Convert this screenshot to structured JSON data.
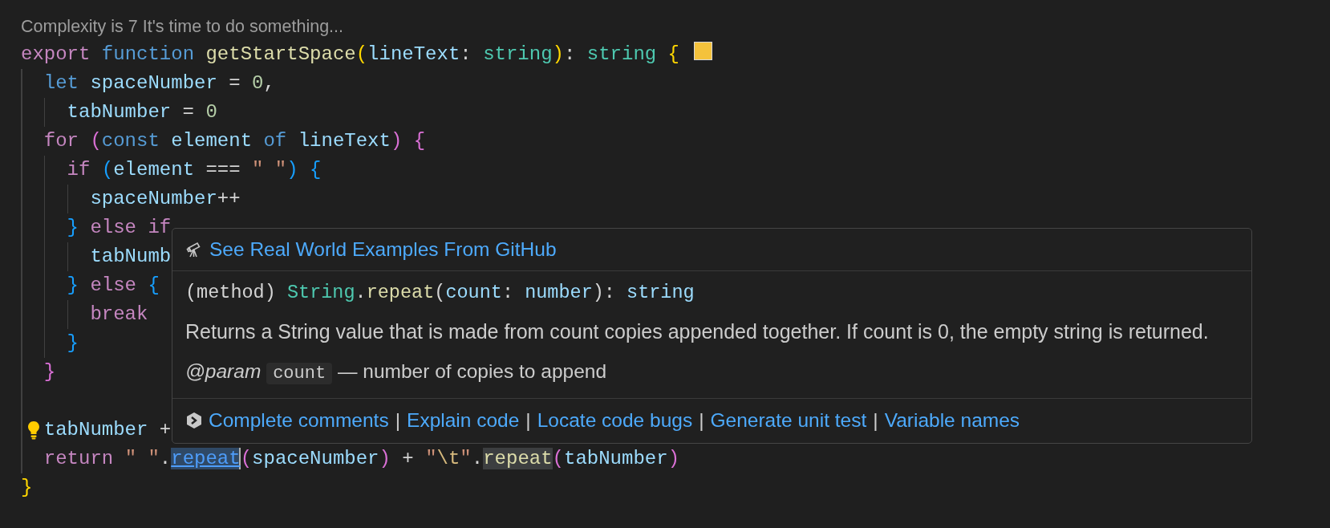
{
  "codelens": "Complexity is 7 It's time to do something...",
  "code": [
    {
      "swatch": true,
      "tokens": [
        {
          "kind": "kw",
          "text": "export "
        },
        {
          "kind": "st",
          "text": "function "
        },
        {
          "kind": "fn",
          "text": "getStartSpace"
        },
        {
          "kind": "b1",
          "text": "("
        },
        {
          "kind": "var",
          "text": "lineText"
        },
        {
          "kind": "op",
          "text": ": "
        },
        {
          "kind": "type",
          "text": "string"
        },
        {
          "kind": "b1",
          "text": ")"
        },
        {
          "kind": "op",
          "text": ": "
        },
        {
          "kind": "type",
          "text": "string "
        },
        {
          "kind": "b1",
          "text": "{"
        }
      ],
      "children": [
        {
          "tokens": [
            {
              "kind": "st",
              "text": "let "
            },
            {
              "kind": "var",
              "text": "spaceNumber"
            },
            {
              "kind": "op",
              "text": " = "
            },
            {
              "kind": "num",
              "text": "0"
            },
            {
              "kind": "op",
              "text": ","
            }
          ],
          "children": [
            {
              "tokens": [
                {
                  "kind": "var",
                  "text": "tabNumber"
                },
                {
                  "kind": "op",
                  "text": " = "
                },
                {
                  "kind": "num",
                  "text": "0"
                }
              ]
            }
          ]
        },
        {
          "tokens": [
            {
              "kind": "kw",
              "text": "for "
            },
            {
              "kind": "b2",
              "text": "("
            },
            {
              "kind": "st",
              "text": "const "
            },
            {
              "kind": "var",
              "text": "element "
            },
            {
              "kind": "st",
              "text": "of "
            },
            {
              "kind": "var",
              "text": "lineText"
            },
            {
              "kind": "b2",
              "text": ") {"
            }
          ],
          "children": [
            {
              "tokens": [
                {
                  "kind": "kw",
                  "text": "if "
                },
                {
                  "kind": "b3",
                  "text": "("
                },
                {
                  "kind": "var",
                  "text": "element"
                },
                {
                  "kind": "op",
                  "text": " === "
                },
                {
                  "kind": "str",
                  "text": "\" \""
                },
                {
                  "kind": "b3",
                  "text": ") {"
                }
              ],
              "children": [
                {
                  "tokens": [
                    {
                      "kind": "var",
                      "text": "spaceNumber"
                    },
                    {
                      "kind": "op",
                      "text": "++"
                    }
                  ]
                }
              ]
            },
            {
              "tokens": [
                {
                  "kind": "b3",
                  "text": "}"
                },
                {
                  "kind": "kw",
                  "text": " else if"
                }
              ],
              "children": [
                {
                  "tokens": [
                    {
                      "kind": "var",
                      "text": "tabNumb"
                    }
                  ]
                }
              ]
            },
            {
              "tokens": [
                {
                  "kind": "b3",
                  "text": "}"
                },
                {
                  "kind": "kw",
                  "text": " else "
                },
                {
                  "kind": "b3",
                  "text": "{"
                }
              ],
              "children": [
                {
                  "tokens": [
                    {
                      "kind": "kw",
                      "text": "break"
                    }
                  ]
                }
              ]
            },
            {
              "tokens": [
                {
                  "kind": "b3",
                  "text": "}"
                }
              ]
            }
          ]
        },
        {
          "tokens": [
            {
              "kind": "b2",
              "text": "}"
            }
          ]
        },
        {
          "blank_line_before": true,
          "bulb": true,
          "tokens": [
            {
              "kind": "var",
              "text": "tabNumber"
            },
            {
              "kind": "op",
              "text": " +"
            }
          ]
        },
        {
          "tokens": [
            {
              "kind": "kw",
              "text": "return "
            },
            {
              "kind": "str",
              "text": "\" \""
            },
            {
              "kind": "op",
              "text": "."
            },
            {
              "kind": "fn",
              "text": "repeat",
              "selected": true,
              "cursor": true
            },
            {
              "kind": "b2",
              "text": "("
            },
            {
              "kind": "var",
              "text": "spaceNumber"
            },
            {
              "kind": "b2",
              "text": ")"
            },
            {
              "kind": "op",
              "text": " + "
            },
            {
              "kind": "str",
              "text": "\""
            },
            {
              "kind": "esc",
              "text": "\\t"
            },
            {
              "kind": "str",
              "text": "\""
            },
            {
              "kind": "op",
              "text": "."
            },
            {
              "kind": "fn",
              "text": "repeat",
              "highlighted": true
            },
            {
              "kind": "b2",
              "text": "("
            },
            {
              "kind": "var",
              "text": "tabNumber"
            },
            {
              "kind": "b2",
              "text": ")"
            }
          ]
        }
      ]
    },
    {
      "tokens": [
        {
          "kind": "b1",
          "text": "}"
        }
      ]
    }
  ],
  "hover": {
    "examples_link": "See Real World Examples From GitHub",
    "signature": [
      {
        "kind": "op",
        "text": "(method) "
      },
      {
        "kind": "type",
        "text": "String"
      },
      {
        "kind": "op",
        "text": "."
      },
      {
        "kind": "fn",
        "text": "repeat"
      },
      {
        "kind": "op",
        "text": "("
      },
      {
        "kind": "var",
        "text": "count"
      },
      {
        "kind": "op",
        "text": ": "
      },
      {
        "kind": "var",
        "text": "number"
      },
      {
        "kind": "op",
        "text": "): "
      },
      {
        "kind": "var",
        "text": "string"
      }
    ],
    "description": "Returns a String value that is made from count copies appended together. If count is 0, the empty string is returned.",
    "param": {
      "tag": "@param",
      "name": "count",
      "text": "— number of copies to append"
    },
    "actions": [
      {
        "kind": "link",
        "text": "Complete comments"
      },
      {
        "kind": "separator",
        "text": "|"
      },
      {
        "kind": "link",
        "text": "Explain code"
      },
      {
        "kind": "separator",
        "text": "|"
      },
      {
        "kind": "link",
        "text": "Locate code bugs"
      },
      {
        "kind": "separator",
        "text": "|"
      },
      {
        "kind": "link",
        "text": "Generate unit test"
      },
      {
        "kind": "separator",
        "text": "|"
      },
      {
        "kind": "link",
        "text": "Variable names"
      }
    ]
  }
}
